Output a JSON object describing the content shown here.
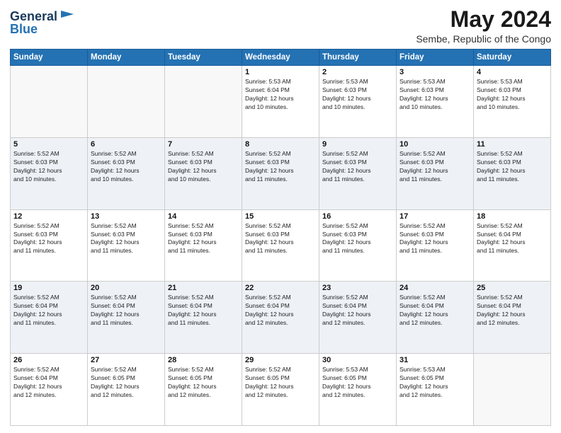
{
  "logo": {
    "line1": "General",
    "line2": "Blue"
  },
  "title": "May 2024",
  "location": "Sembe, Republic of the Congo",
  "days_of_week": [
    "Sunday",
    "Monday",
    "Tuesday",
    "Wednesday",
    "Thursday",
    "Friday",
    "Saturday"
  ],
  "weeks": [
    [
      {
        "day": "",
        "text": ""
      },
      {
        "day": "",
        "text": ""
      },
      {
        "day": "",
        "text": ""
      },
      {
        "day": "1",
        "text": "Sunrise: 5:53 AM\nSunset: 6:04 PM\nDaylight: 12 hours\nand 10 minutes."
      },
      {
        "day": "2",
        "text": "Sunrise: 5:53 AM\nSunset: 6:03 PM\nDaylight: 12 hours\nand 10 minutes."
      },
      {
        "day": "3",
        "text": "Sunrise: 5:53 AM\nSunset: 6:03 PM\nDaylight: 12 hours\nand 10 minutes."
      },
      {
        "day": "4",
        "text": "Sunrise: 5:53 AM\nSunset: 6:03 PM\nDaylight: 12 hours\nand 10 minutes."
      }
    ],
    [
      {
        "day": "5",
        "text": "Sunrise: 5:52 AM\nSunset: 6:03 PM\nDaylight: 12 hours\nand 10 minutes."
      },
      {
        "day": "6",
        "text": "Sunrise: 5:52 AM\nSunset: 6:03 PM\nDaylight: 12 hours\nand 10 minutes."
      },
      {
        "day": "7",
        "text": "Sunrise: 5:52 AM\nSunset: 6:03 PM\nDaylight: 12 hours\nand 10 minutes."
      },
      {
        "day": "8",
        "text": "Sunrise: 5:52 AM\nSunset: 6:03 PM\nDaylight: 12 hours\nand 11 minutes."
      },
      {
        "day": "9",
        "text": "Sunrise: 5:52 AM\nSunset: 6:03 PM\nDaylight: 12 hours\nand 11 minutes."
      },
      {
        "day": "10",
        "text": "Sunrise: 5:52 AM\nSunset: 6:03 PM\nDaylight: 12 hours\nand 11 minutes."
      },
      {
        "day": "11",
        "text": "Sunrise: 5:52 AM\nSunset: 6:03 PM\nDaylight: 12 hours\nand 11 minutes."
      }
    ],
    [
      {
        "day": "12",
        "text": "Sunrise: 5:52 AM\nSunset: 6:03 PM\nDaylight: 12 hours\nand 11 minutes."
      },
      {
        "day": "13",
        "text": "Sunrise: 5:52 AM\nSunset: 6:03 PM\nDaylight: 12 hours\nand 11 minutes."
      },
      {
        "day": "14",
        "text": "Sunrise: 5:52 AM\nSunset: 6:03 PM\nDaylight: 12 hours\nand 11 minutes."
      },
      {
        "day": "15",
        "text": "Sunrise: 5:52 AM\nSunset: 6:03 PM\nDaylight: 12 hours\nand 11 minutes."
      },
      {
        "day": "16",
        "text": "Sunrise: 5:52 AM\nSunset: 6:03 PM\nDaylight: 12 hours\nand 11 minutes."
      },
      {
        "day": "17",
        "text": "Sunrise: 5:52 AM\nSunset: 6:03 PM\nDaylight: 12 hours\nand 11 minutes."
      },
      {
        "day": "18",
        "text": "Sunrise: 5:52 AM\nSunset: 6:04 PM\nDaylight: 12 hours\nand 11 minutes."
      }
    ],
    [
      {
        "day": "19",
        "text": "Sunrise: 5:52 AM\nSunset: 6:04 PM\nDaylight: 12 hours\nand 11 minutes."
      },
      {
        "day": "20",
        "text": "Sunrise: 5:52 AM\nSunset: 6:04 PM\nDaylight: 12 hours\nand 11 minutes."
      },
      {
        "day": "21",
        "text": "Sunrise: 5:52 AM\nSunset: 6:04 PM\nDaylight: 12 hours\nand 11 minutes."
      },
      {
        "day": "22",
        "text": "Sunrise: 5:52 AM\nSunset: 6:04 PM\nDaylight: 12 hours\nand 12 minutes."
      },
      {
        "day": "23",
        "text": "Sunrise: 5:52 AM\nSunset: 6:04 PM\nDaylight: 12 hours\nand 12 minutes."
      },
      {
        "day": "24",
        "text": "Sunrise: 5:52 AM\nSunset: 6:04 PM\nDaylight: 12 hours\nand 12 minutes."
      },
      {
        "day": "25",
        "text": "Sunrise: 5:52 AM\nSunset: 6:04 PM\nDaylight: 12 hours\nand 12 minutes."
      }
    ],
    [
      {
        "day": "26",
        "text": "Sunrise: 5:52 AM\nSunset: 6:04 PM\nDaylight: 12 hours\nand 12 minutes."
      },
      {
        "day": "27",
        "text": "Sunrise: 5:52 AM\nSunset: 6:05 PM\nDaylight: 12 hours\nand 12 minutes."
      },
      {
        "day": "28",
        "text": "Sunrise: 5:52 AM\nSunset: 6:05 PM\nDaylight: 12 hours\nand 12 minutes."
      },
      {
        "day": "29",
        "text": "Sunrise: 5:52 AM\nSunset: 6:05 PM\nDaylight: 12 hours\nand 12 minutes."
      },
      {
        "day": "30",
        "text": "Sunrise: 5:53 AM\nSunset: 6:05 PM\nDaylight: 12 hours\nand 12 minutes."
      },
      {
        "day": "31",
        "text": "Sunrise: 5:53 AM\nSunset: 6:05 PM\nDaylight: 12 hours\nand 12 minutes."
      },
      {
        "day": "",
        "text": ""
      }
    ]
  ]
}
